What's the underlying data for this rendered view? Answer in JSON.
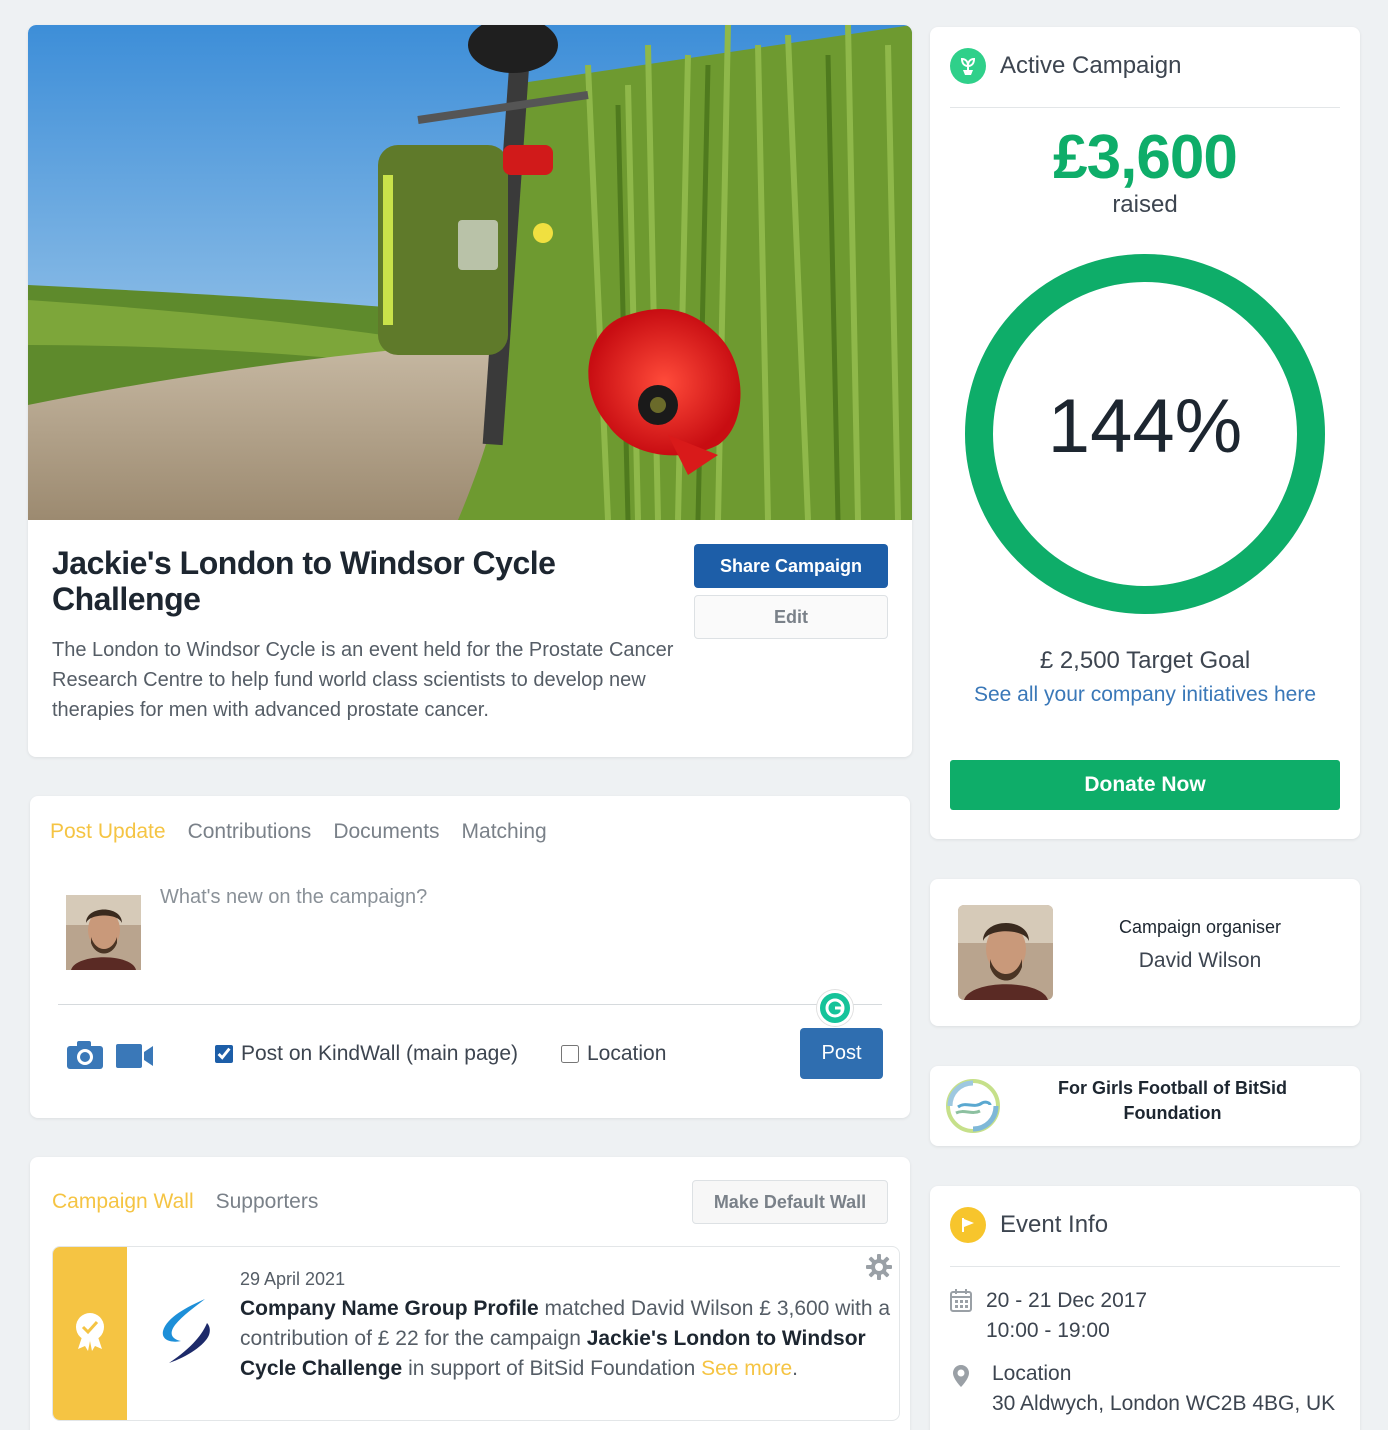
{
  "hero": {
    "title": "Jackie's London to Windsor Cycle Challenge",
    "description": "The London to Windsor Cycle is an event held for the Prostate Cancer Research Centre to help fund world class scientists to develop new therapies for men with advanced prostate cancer.",
    "share_label": "Share Campaign",
    "edit_label": "Edit"
  },
  "post": {
    "tabs": [
      "Post Update",
      "Contributions",
      "Documents",
      "Matching"
    ],
    "placeholder": "What's new on the campaign?",
    "kindwall_label": "Post on KindWall (main page)",
    "kindwall_checked": true,
    "location_label": "Location",
    "location_checked": false,
    "post_label": "Post"
  },
  "wall": {
    "tabs": [
      "Campaign Wall",
      "Supporters"
    ],
    "default_label": "Make Default Wall",
    "item": {
      "date": "29 April 2021",
      "company": "Company Name Group Profile",
      "text1": " matched David Wilson £ 3,600 with a contribution of £ 22 for the campaign ",
      "campaign": "Jackie's London to Windsor Cycle Challenge",
      "text2": " in support of BitSid Foundation ",
      "see_more": "See more",
      "end": "."
    }
  },
  "campaign": {
    "status": "Active Campaign",
    "raised_amount": "£3,600",
    "raised_label": "raised",
    "percent_text": "144%",
    "progress_fraction": 1.0,
    "target_goal": "£ 2,500 Target Goal",
    "initiatives_link": "See all your company initiatives here",
    "donate_label": "Donate Now"
  },
  "organiser": {
    "label": "Campaign organiser",
    "name": "David Wilson"
  },
  "foundation": {
    "name": "For Girls Football of BitSid Foundation"
  },
  "event": {
    "title": "Event Info",
    "date": "20 - 21 Dec 2017",
    "time": "10:00 - 19:00",
    "location_label": "Location",
    "address": "30 Aldwych, London WC2B 4BG, UK"
  },
  "colors": {
    "accent_green": "#0ead69",
    "accent_blue": "#1d5ea8",
    "accent_yellow": "#f5c443"
  },
  "icons": [
    "camera-icon",
    "video-icon",
    "gear-icon",
    "award-icon",
    "plant-icon",
    "flag-icon",
    "calendar-icon",
    "map-pin-icon",
    "grammarly-icon"
  ]
}
